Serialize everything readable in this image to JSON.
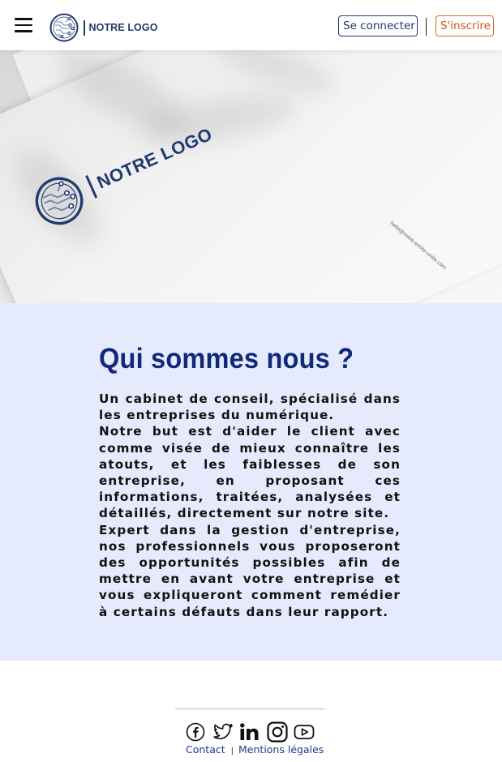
{
  "header": {
    "menu_icon": "hamburger-menu-icon",
    "logo_icon": "circuit-circle-logo-icon",
    "logo_text": "NOTRE LOGO",
    "login_label": "Se connecter",
    "signup_label": "S'inscrire",
    "colors": {
      "brand_blue": "#1f3a6e",
      "signup_orange": "#e0662a"
    }
  },
  "hero": {
    "logo_text": "NOTRE LOGO",
    "paper_small_text": "hello@notre-entite-unite.com"
  },
  "about": {
    "title": "Qui sommes nous ?",
    "paragraphs": [
      "Un cabinet de conseil, spécialisé dans les entreprises du numérique.",
      "Notre but est d'aider le client avec comme visée de mieux connaître les atouts, et les faiblesses de son entreprise, en proposant ces informations, traitées, analysées et détaillés, directement sur notre site.",
      "Expert dans la gestion d'entreprise, nos professionnels vous proposeront des opportunités possibles afin de mettre en avant votre entreprise et vous expliqueront comment remédier à certains défauts dans leur rapport."
    ],
    "colors": {
      "background": "#e5ebfc",
      "title": "#0f2a7a"
    }
  },
  "footer": {
    "social_icons": [
      "facebook-icon",
      "twitter-icon",
      "linkedin-icon",
      "instagram-icon",
      "youtube-icon"
    ],
    "links": {
      "contact": "Contact",
      "separator": "|",
      "legal": "Mentions légales"
    }
  }
}
